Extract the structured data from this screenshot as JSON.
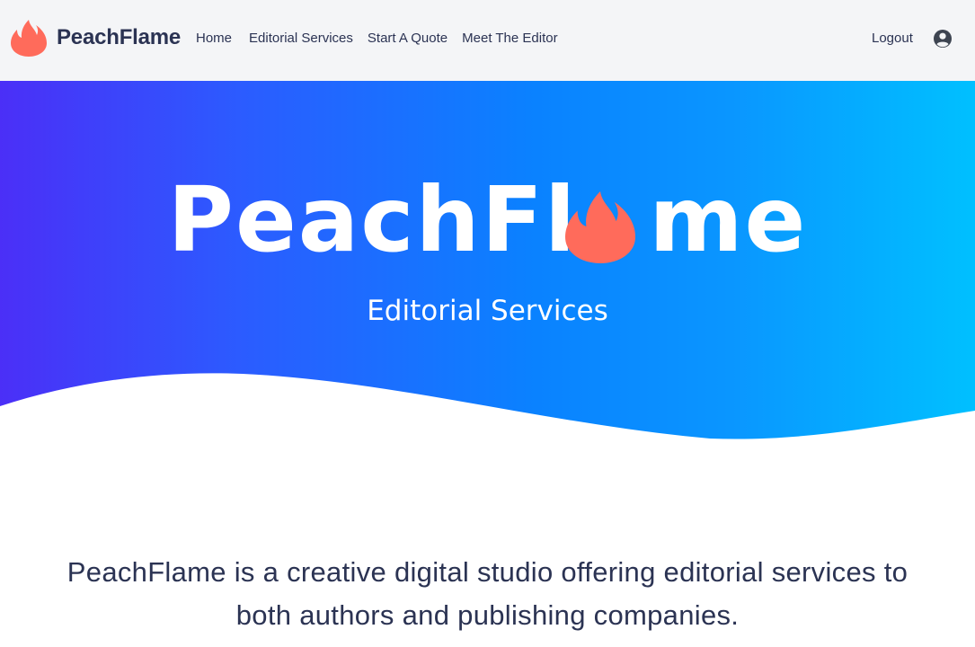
{
  "brand": {
    "name": "PeachFlame",
    "icon": "flame-icon",
    "accent": "#ff6b5b"
  },
  "nav": {
    "links": [
      {
        "label": "Home"
      },
      {
        "label": "Editorial Services"
      },
      {
        "label": "Start A Quote"
      },
      {
        "label": "Meet The Editor"
      }
    ],
    "logout_label": "Logout",
    "user_icon": "user-circle-icon"
  },
  "hero": {
    "title_left": "PeachFl",
    "title_right": "me",
    "title_glyph_icon": "flame-icon",
    "subtitle": "Editorial Services",
    "gradient": [
      "#4b2ff7",
      "#0a82ff",
      "#00c0ff"
    ]
  },
  "intro": {
    "text": "PeachFlame is a creative digital studio offering editorial services to both authors and publishing companies."
  }
}
